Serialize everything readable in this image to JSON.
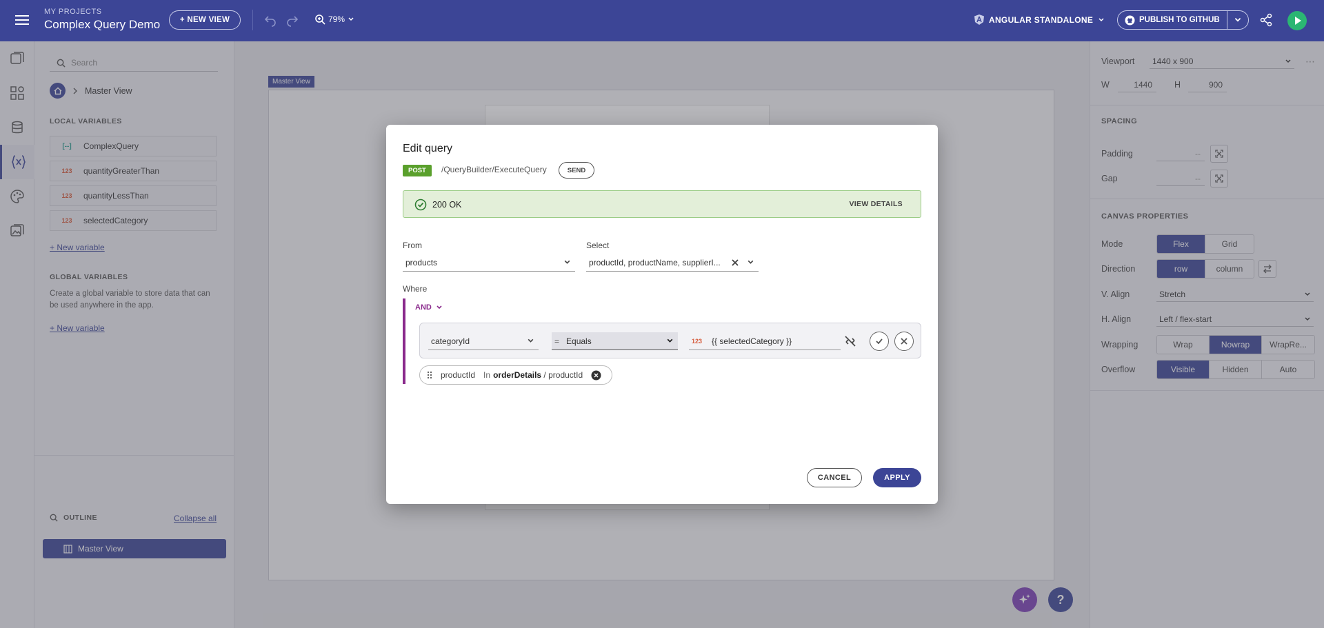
{
  "topbar": {
    "section_label": "MY PROJECTS",
    "project_name": "Complex Query Demo",
    "new_view_label": "+ NEW VIEW",
    "zoom": "79%",
    "framework": "ANGULAR STANDALONE",
    "publish_label": "PUBLISH TO GITHUB"
  },
  "sidebar": {
    "search_placeholder": "Search",
    "breadcrumb_current": "Master View",
    "local_title": "LOCAL VARIABLES",
    "local_vars": [
      {
        "icon": "[--]",
        "name": "ComplexQuery"
      },
      {
        "icon": "123",
        "name": "quantityGreaterThan"
      },
      {
        "icon": "123",
        "name": "quantityLessThan"
      },
      {
        "icon": "123",
        "name": "selectedCategory"
      }
    ],
    "new_variable": "+ New variable",
    "global_title": "GLOBAL VARIABLES",
    "global_desc": "Create a global variable to store data that can be used anywhere in the app.",
    "global_new_variable": "+ New variable",
    "outline_title": "OUTLINE",
    "collapse_all": "Collapse all",
    "outline_item": "Master View"
  },
  "canvas": {
    "master_tag": "Master View"
  },
  "right_panel": {
    "viewport_label": "Viewport",
    "viewport_value": "1440 x 900",
    "w_label": "W",
    "w_value": "1440",
    "h_label": "H",
    "h_value": "900",
    "spacing_title": "SPACING",
    "padding_label": "Padding",
    "padding_value": "--",
    "gap_label": "Gap",
    "gap_value": "--",
    "canvas_title": "CANVAS PROPERTIES",
    "mode_label": "Mode",
    "mode_flex": "Flex",
    "mode_grid": "Grid",
    "direction_label": "Direction",
    "dir_row": "row",
    "dir_column": "column",
    "valign_label": "V. Align",
    "valign_value": "Stretch",
    "halign_label": "H. Align",
    "halign_value": "Left / flex-start",
    "wrapping_label": "Wrapping",
    "wrap": "Wrap",
    "nowrap": "Nowrap",
    "wrapre": "WrapRe...",
    "overflow_label": "Overflow",
    "visible": "Visible",
    "hidden": "Hidden",
    "auto": "Auto"
  },
  "dialog": {
    "title": "Edit query",
    "method": "POST",
    "endpoint": "/QueryBuilder/ExecuteQuery",
    "send": "SEND",
    "status_text": "200 OK",
    "view_details": "VIEW DETAILS",
    "from_label": "From",
    "from_value": "products",
    "select_label": "Select",
    "select_value": "productId, productName, supplierI...",
    "where_label": "Where",
    "and_label": "AND",
    "cond_field": "categoryId",
    "cond_operator": "Equals",
    "cond_operator_symbol": "=",
    "cond_type": "123",
    "cond_value": "{{ selectedCategory }}",
    "chip_field": "productId",
    "chip_op": "In",
    "chip_source": "orderDetails",
    "chip_sep": " / ",
    "chip_target": "productId",
    "cancel": "CANCEL",
    "apply": "APPLY"
  },
  "colors": {
    "brand": "#3c4596",
    "success": "#5aa02c",
    "and_accent": "#8a2a8c",
    "run": "#2bb673"
  }
}
